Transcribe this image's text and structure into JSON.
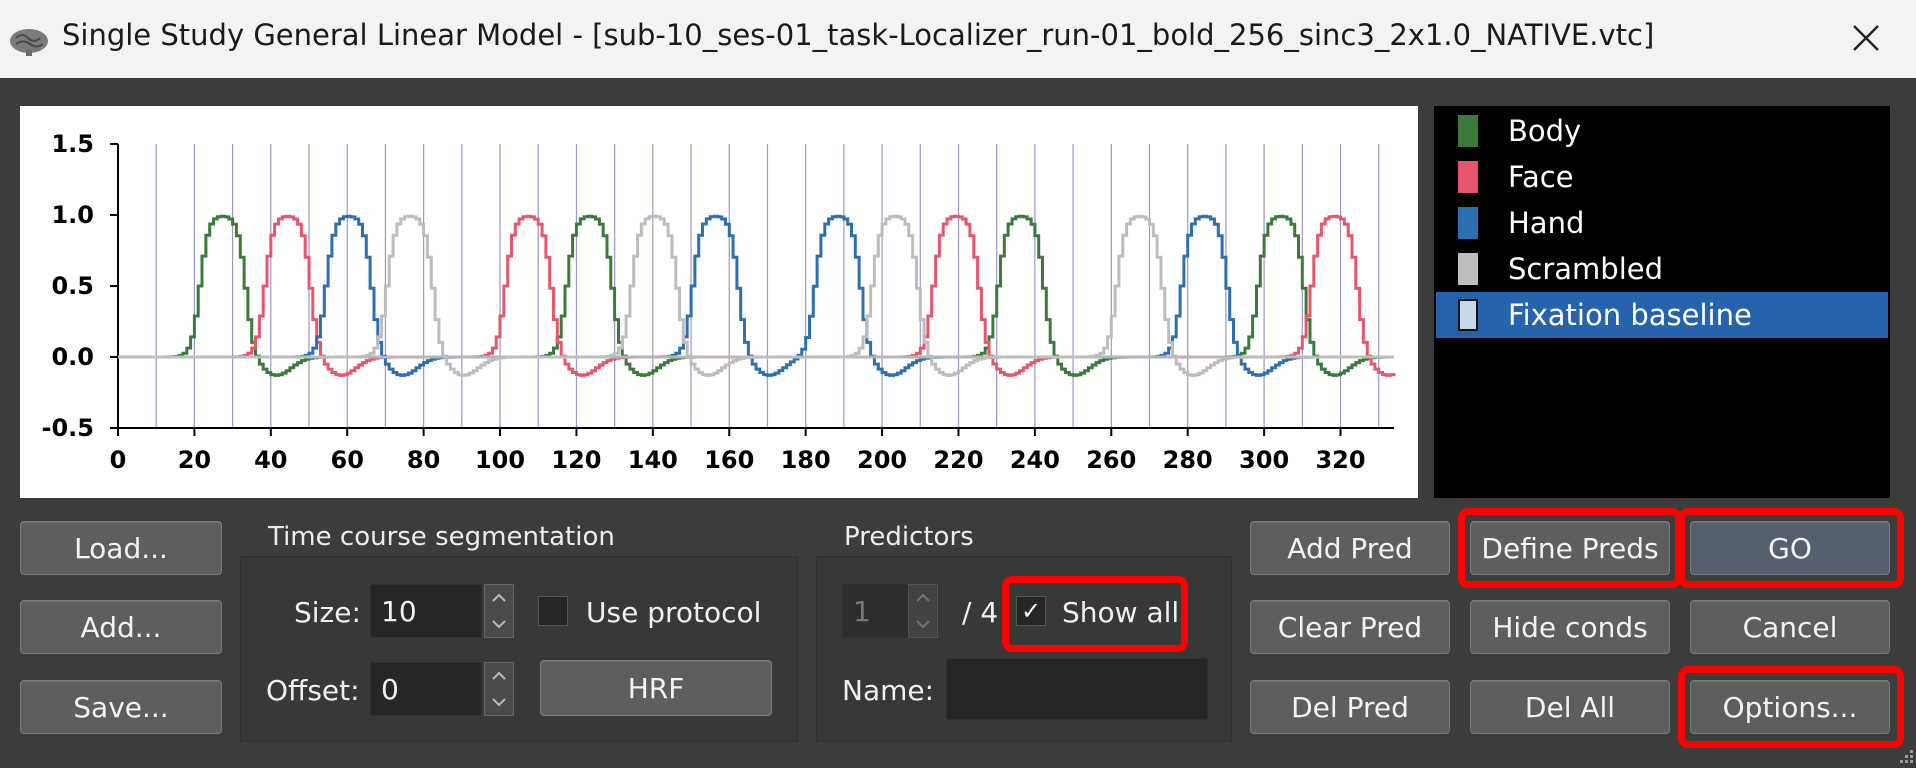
{
  "window": {
    "title": "Single Study General Linear Model - [sub-10_ses-01_task-Localizer_run-01_bold_256_sinc3_2x1.0_NATIVE.vtc]",
    "app_icon": "brain-icon",
    "close_icon": "close-icon"
  },
  "chart_data": {
    "type": "line",
    "xlabel": "",
    "ylabel": "",
    "xlim": [
      0,
      334
    ],
    "ylim": [
      -0.5,
      1.5
    ],
    "x_ticks": [
      "0",
      "20",
      "40",
      "60",
      "80",
      "100",
      "120",
      "140",
      "160",
      "180",
      "200",
      "220",
      "240",
      "260",
      "280",
      "300",
      "320"
    ],
    "y_ticks": [
      "1.5",
      "1.0",
      "0.5",
      "0.0",
      "-0.5"
    ],
    "y_tick_values": [
      1.5,
      1.0,
      0.5,
      0.0,
      -0.5
    ],
    "x_tick_values": [
      0,
      20,
      40,
      60,
      80,
      100,
      120,
      140,
      160,
      180,
      200,
      220,
      240,
      260,
      280,
      300,
      320
    ],
    "segment_lines_x": [
      10,
      20,
      30,
      40,
      50,
      60,
      70,
      80,
      90,
      100,
      110,
      120,
      130,
      140,
      150,
      160,
      170,
      180,
      190,
      200,
      210,
      220,
      230,
      240,
      250,
      260,
      270,
      280,
      290,
      300,
      310,
      320,
      330
    ],
    "grid": false,
    "series": [
      {
        "name": "Body",
        "color": "#3b7a3b",
        "peaks": [
          27,
          123,
          236,
          304
        ]
      },
      {
        "name": "Face",
        "color": "#e8566e",
        "peaks": [
          44,
          107,
          219,
          318
        ]
      },
      {
        "name": "Hand",
        "color": "#2e6fb0",
        "peaks": [
          60,
          156,
          188,
          284
        ]
      },
      {
        "name": "Scrambled",
        "color": "#bdbdbd",
        "peaks": [
          76,
          140,
          203,
          267
        ]
      }
    ],
    "peak_height": 1.0,
    "undershoot": -0.13
  },
  "legend": {
    "items": [
      {
        "label": "Body",
        "color": "#3b7a3b",
        "selected": false
      },
      {
        "label": "Face",
        "color": "#e8566e",
        "selected": false
      },
      {
        "label": "Hand",
        "color": "#2e6fb0",
        "selected": false
      },
      {
        "label": "Scrambled",
        "color": "#bdbdbd",
        "selected": false
      },
      {
        "label": "Fixation baseline",
        "color": "#c8d8ec",
        "selected": true
      }
    ]
  },
  "left_buttons": {
    "load": "Load...",
    "add": "Add...",
    "save": "Save..."
  },
  "segmentation": {
    "title": "Time course segmentation",
    "size_label": "Size:",
    "size_value": "10",
    "offset_label": "Offset:",
    "offset_value": "0",
    "use_protocol_label": "Use protocol",
    "use_protocol_checked": false,
    "hrf_label": "HRF"
  },
  "predictors": {
    "title": "Predictors",
    "index_value": "1",
    "total_label": "/ 4",
    "show_all_label": "Show all",
    "show_all_checked": true,
    "check_glyph": "✓",
    "name_label": "Name:",
    "name_value": ""
  },
  "right_buttons": {
    "add_pred": "Add Pred",
    "define_preds": "Define Preds",
    "go": "GO",
    "clear_pred": "Clear Pred",
    "hide_conds": "Hide conds",
    "cancel": "Cancel",
    "del_pred": "Del Pred",
    "del_all": "Del All",
    "options": "Options..."
  },
  "highlight_color": "#ff0000"
}
